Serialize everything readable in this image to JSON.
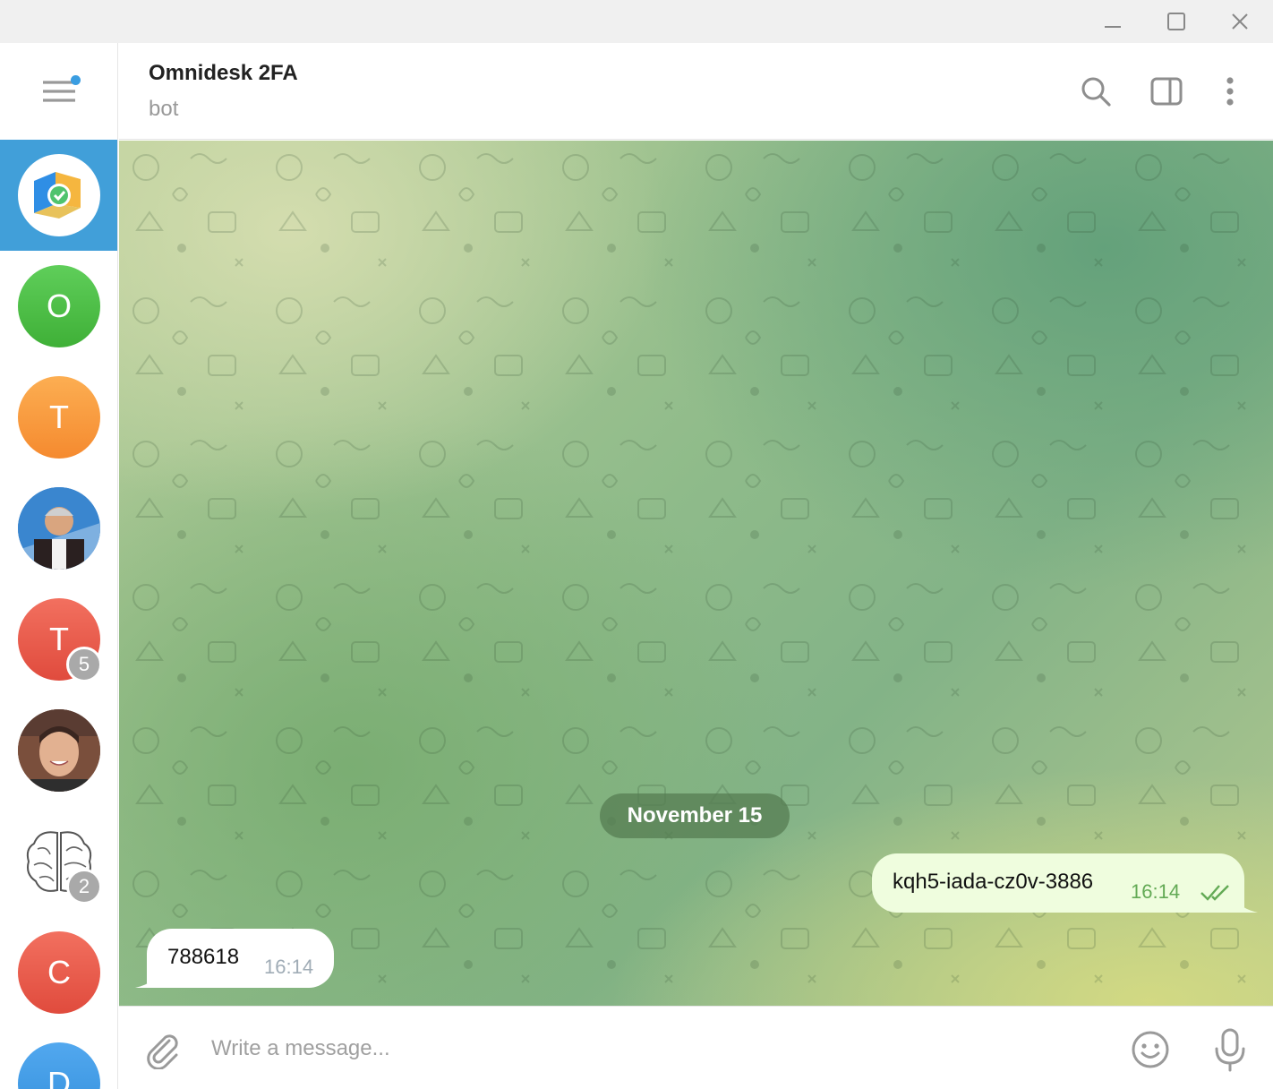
{
  "window": {
    "controls": {
      "minimize_icon": "minimize-icon",
      "maximize_icon": "maximize-icon",
      "close_icon": "close-icon"
    }
  },
  "sidebar": {
    "menu_icon": "hamburger-menu-icon",
    "menu_has_notification": true,
    "chats": [
      {
        "initial": "",
        "avatar": "omnidesk-logo",
        "active": true,
        "color": "#419fd9"
      },
      {
        "initial": "O",
        "color": "#4cbf45"
      },
      {
        "initial": "T",
        "color": "#f79a3e"
      },
      {
        "initial": "",
        "avatar": "photo-person-suit"
      },
      {
        "initial": "T",
        "color": "#e8574a",
        "badge": "5"
      },
      {
        "initial": "",
        "avatar": "photo-smiling-man"
      },
      {
        "initial": "",
        "avatar": "brain-drawing",
        "badge": "2"
      },
      {
        "initial": "C",
        "color": "#e8574a"
      },
      {
        "initial": "D",
        "color": "#3f98e4"
      }
    ]
  },
  "header": {
    "title": "Omnidesk 2FA",
    "status": "bot",
    "icons": [
      "search-icon",
      "sidebar-toggle-icon",
      "more-vertical-icon"
    ]
  },
  "chat": {
    "date_separator": "November 15",
    "messages": [
      {
        "direction": "out",
        "text": "kqh5-iada-cz0v-3886",
        "time": "16:14",
        "status": "read"
      },
      {
        "direction": "in",
        "text": "788618",
        "time": "16:14"
      }
    ]
  },
  "composer": {
    "placeholder": "Write a message...",
    "icons": [
      "attach-icon",
      "emoji-icon",
      "microphone-icon"
    ]
  },
  "colors": {
    "accent": "#419fd9",
    "outgoing_bubble": "#effdde",
    "outgoing_time": "#63aa55",
    "incoming_time": "#a0acb6"
  }
}
